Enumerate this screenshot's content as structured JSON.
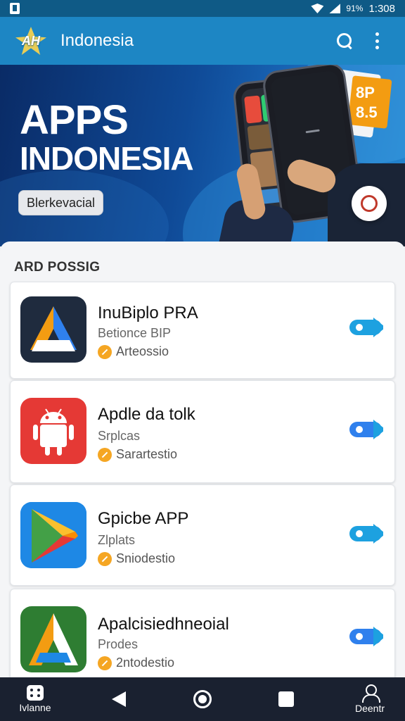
{
  "status_bar": {
    "battery": "91%",
    "time": "1:308"
  },
  "app_bar": {
    "logo_text": "AH",
    "title": "Indonesia"
  },
  "hero": {
    "title_line1": "APPS",
    "title_line2": "INDONESIA",
    "button_label": "Blerkevacial",
    "badge_text": "8P\n8.5"
  },
  "list": {
    "section_title": "ARD POSSIG",
    "apps": [
      {
        "name": "InuBiplo PRA",
        "subtitle": "Betionce BIP",
        "meta": "Arteossio",
        "icon": "delta-triangle-icon"
      },
      {
        "name": "Apdle da tolk",
        "subtitle": "Srplcas",
        "meta": "Sarartestio",
        "icon": "android-robot-icon"
      },
      {
        "name": "Gpicbe APP",
        "subtitle": "Zlplats",
        "meta": "Sniodestio",
        "icon": "play-triangle-icon"
      },
      {
        "name": "Apalcisiedhneoial",
        "subtitle": "Prodes",
        "meta": "2ntodestio",
        "icon": "a-letter-icon"
      }
    ]
  },
  "bottom_nav": {
    "left_label": "Ivlanne",
    "right_label": "Deentr"
  },
  "colors": {
    "app_bar": "#1d86c4",
    "accent": "#1da1e0",
    "coin": "#f5a623",
    "nav": "#1a2130"
  }
}
